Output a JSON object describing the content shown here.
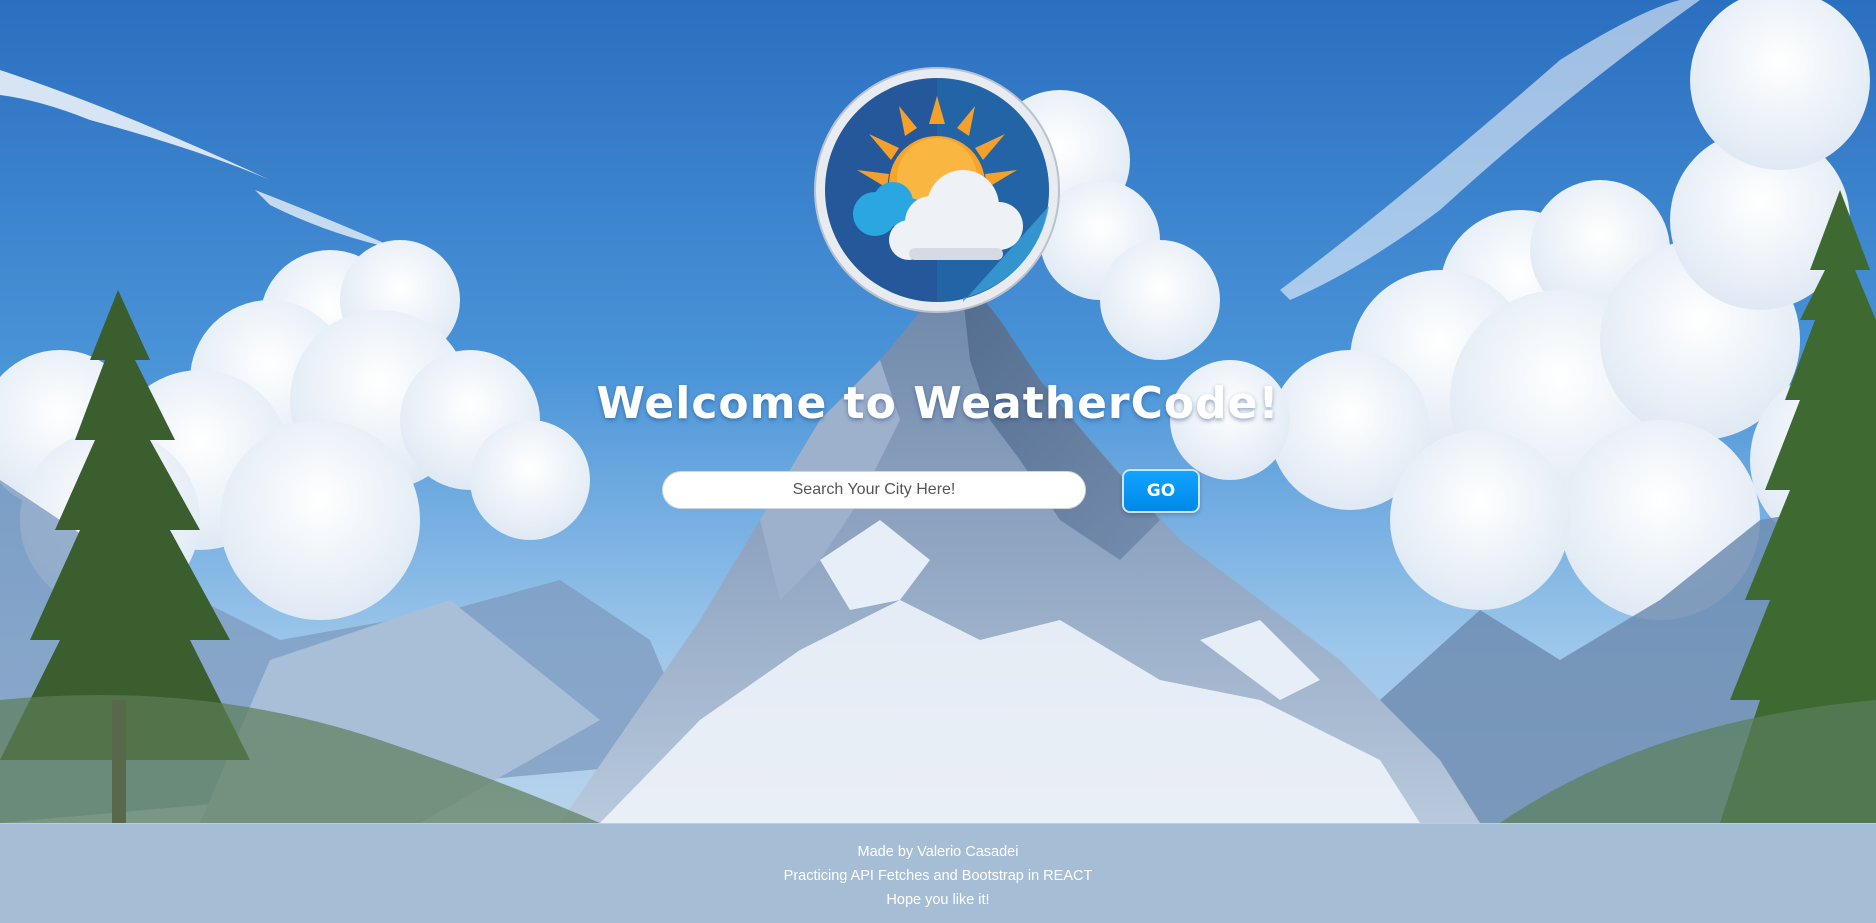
{
  "header": {
    "logo_icon": "sun-cloud-weather-icon",
    "title": "Welcome to WeatherCode!"
  },
  "search": {
    "placeholder": "Search Your City Here!",
    "value": "",
    "go_label": "GO"
  },
  "footer": {
    "line1": "Made by Valerio Casadei",
    "line2": "Practicing API Fetches and Bootstrap in REACT",
    "line3": "Hope you like it!"
  },
  "colors": {
    "go_button": "#0a96f5",
    "title_text": "#ffffff",
    "logo_ring_bg": "#2c5f9e",
    "sun": "#f7a42c"
  }
}
